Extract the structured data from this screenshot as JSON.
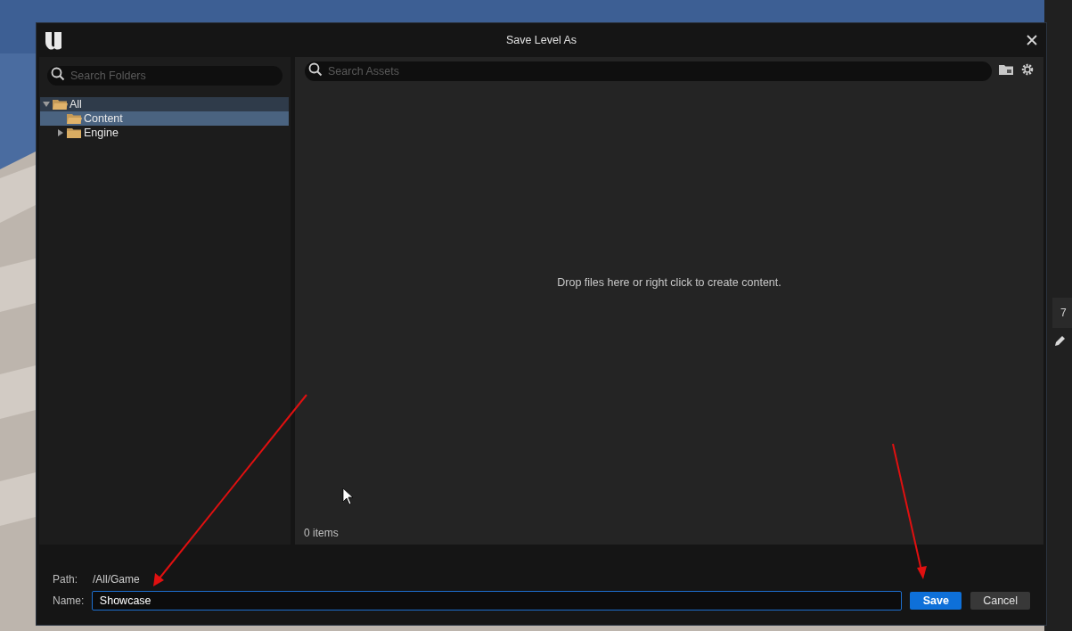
{
  "dialog": {
    "title": "Save Level As"
  },
  "folder_search": {
    "placeholder": "Search Folders"
  },
  "tree": [
    {
      "label": "All",
      "expanded": true,
      "selected": false,
      "hovered": true,
      "children": [
        {
          "label": "Content",
          "selected": true
        },
        {
          "label": "Engine",
          "expanded": false,
          "selected": false
        }
      ]
    }
  ],
  "asset_search": {
    "placeholder": "Search Assets"
  },
  "empty_message": "Drop files here or right click to create content.",
  "item_count": "0 items",
  "path": {
    "label": "Path:",
    "value": "/All/Game"
  },
  "name": {
    "label": "Name:",
    "value": "Showcase"
  },
  "buttons": [
    {
      "label": "Save",
      "kind": "primary"
    },
    {
      "label": "Cancel",
      "kind": "secondary"
    }
  ],
  "side_tab": {
    "label": "7"
  }
}
